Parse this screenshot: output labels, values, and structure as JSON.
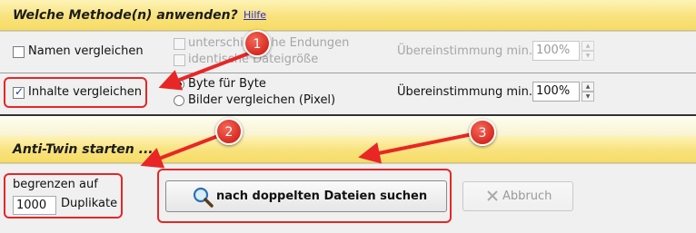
{
  "method_section": {
    "title": "Welche Methode(n) anwenden?",
    "help_link": "Hilfe"
  },
  "row_names": {
    "checkbox_label": "Namen vergleichen",
    "checked": false,
    "sub_options": [
      {
        "label": "unterschiedliche Endungen",
        "checked": false
      },
      {
        "label": "identische Dateigröße",
        "checked": false
      }
    ],
    "match_label": "Übereinstimmung min.",
    "match_value": "100%"
  },
  "row_content": {
    "checkbox_label": "Inhalte vergleichen",
    "checked": true,
    "radio_options": [
      {
        "label": "Byte für Byte",
        "selected": true
      },
      {
        "label": "Bilder vergleichen (Pixel)",
        "selected": false
      }
    ],
    "match_label": "Übereinstimmung min.",
    "match_value": "100%"
  },
  "start_section": {
    "title": "Anti-Twin starten ..."
  },
  "limit": {
    "label": "begrenzen auf",
    "value": "1000",
    "unit": "Duplikate"
  },
  "search_button": {
    "label": "nach doppelten Dateien suchen",
    "icon": "magnifier-icon"
  },
  "abort_button": {
    "label": "Abbruch",
    "icon": "x-icon"
  },
  "annotations": {
    "badges": [
      "1",
      "2",
      "3"
    ],
    "color": "#e82626"
  },
  "spinner": {
    "up": "▲",
    "down": "▼"
  }
}
